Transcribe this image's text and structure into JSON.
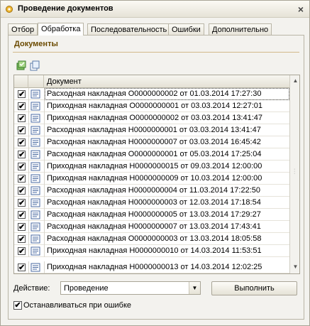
{
  "window": {
    "title": "Проведение документов"
  },
  "tabs": [
    {
      "label": "Отбор",
      "active": false
    },
    {
      "label": "Обработка",
      "active": true
    },
    {
      "label": "Последовательность",
      "active": false
    },
    {
      "label": "Ошибки",
      "active": false
    },
    {
      "label": "Дополнительно",
      "active": false
    }
  ],
  "section": {
    "title": "Документы"
  },
  "grid": {
    "header": "Документ",
    "rows": [
      {
        "checked": true,
        "text": "Расходная накладная О0000000002 от 01.03.2014 17:27:30"
      },
      {
        "checked": true,
        "text": "Приходная накладная О0000000001 от 03.03.2014 12:27:01"
      },
      {
        "checked": true,
        "text": "Приходная накладная О0000000002 от 03.03.2014 13:41:47"
      },
      {
        "checked": true,
        "text": "Расходная накладная Н0000000001 от 03.03.2014 13:41:47"
      },
      {
        "checked": true,
        "text": "Расходная накладная Н0000000007 от 03.03.2014 16:45:42"
      },
      {
        "checked": true,
        "text": "Расходная накладная О0000000001 от 05.03.2014 17:25:04"
      },
      {
        "checked": true,
        "text": "Приходная накладная Н0000000015 от 09.03.2014 12:00:00"
      },
      {
        "checked": true,
        "text": "Приходная накладная Н0000000009 от 10.03.2014 12:00:00"
      },
      {
        "checked": true,
        "text": "Расходная накладная Н0000000004 от 11.03.2014 17:22:50"
      },
      {
        "checked": true,
        "text": "Расходная накладная Н0000000003 от 12.03.2014 17:18:54"
      },
      {
        "checked": true,
        "text": "Расходная накладная Н0000000005 от 13.03.2014 17:29:27"
      },
      {
        "checked": true,
        "text": "Расходная накладная Н0000000007 от 13.03.2014 17:43:41"
      },
      {
        "checked": true,
        "text": "Расходная накладная О0000000003 от 13.03.2014 18:05:58"
      },
      {
        "checked": true,
        "text": "Приходная накладная Н0000000010 от 14.03.2014 11:53:51"
      },
      {
        "checked": true,
        "text": "Приходная накладная Н0000000013 от 14.03.2014 12:02:25"
      }
    ]
  },
  "action": {
    "label": "Действие:",
    "value": "Проведение",
    "run_button": "Выполнить"
  },
  "stop_on_error": {
    "checked": true,
    "label": "Останавливаться при ошибке"
  },
  "icons": {
    "title": "gear-icon",
    "check_all": "check-all-icon",
    "copy": "copy-icon",
    "document": "document-icon",
    "close": "close-icon"
  }
}
